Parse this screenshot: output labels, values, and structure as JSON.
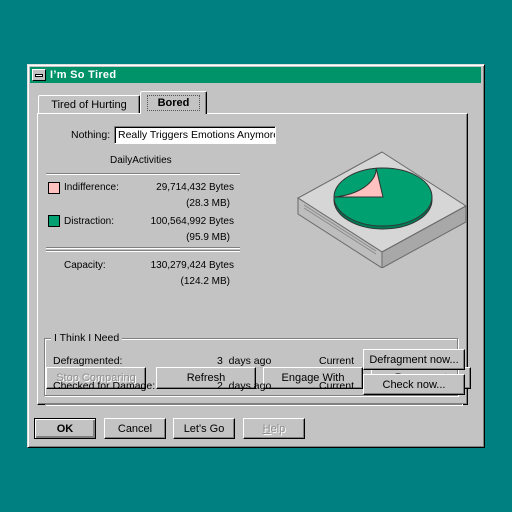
{
  "window": {
    "title": "I’m So Tired",
    "sysmenu_icon": "system-menu-icon"
  },
  "tabs": [
    {
      "label": "Tired of Hurting",
      "active": false
    },
    {
      "label": "Bored",
      "active": true
    }
  ],
  "panel": {
    "name_label": "Nothing:",
    "name_value": "Really Triggers Emotions Anymore",
    "type_label": "DailyActivities",
    "used": {
      "label": "Indifference:",
      "bytes": "29,714,432 Bytes",
      "mb": "(28.3 MB)",
      "color": "#ffc0c0"
    },
    "free": {
      "label": "Distraction:",
      "bytes": "100,564,992 Bytes",
      "mb": "(95.9 MB)",
      "color": "#00a070"
    },
    "capacity": {
      "label": "Capacity:",
      "bytes": "130,279,424 Bytes",
      "mb": "(124.2 MB)"
    },
    "pie": {
      "used_fraction": 0.228,
      "used_color": "#ffc0c0",
      "free_color": "#00a070"
    },
    "buttons": {
      "stop_comparing": "Stop Comparing",
      "refresh": "Refresh",
      "engage_with": "Engage With",
      "reconnect": "Reconnect"
    },
    "group": {
      "label": "I Think I Need",
      "rows": [
        {
          "label": "Defragmented:",
          "age": "3  days ago",
          "status": "Current",
          "action": "Defragment now..."
        },
        {
          "label": "Checked for Damage:",
          "age": "2  days ago",
          "status": "Current",
          "action": "Check now..."
        }
      ]
    }
  },
  "footer": {
    "ok": "OK",
    "cancel": "Cancel",
    "lets_go": "Let's Go",
    "help_prefix": "H",
    "help_rest": "elp"
  }
}
